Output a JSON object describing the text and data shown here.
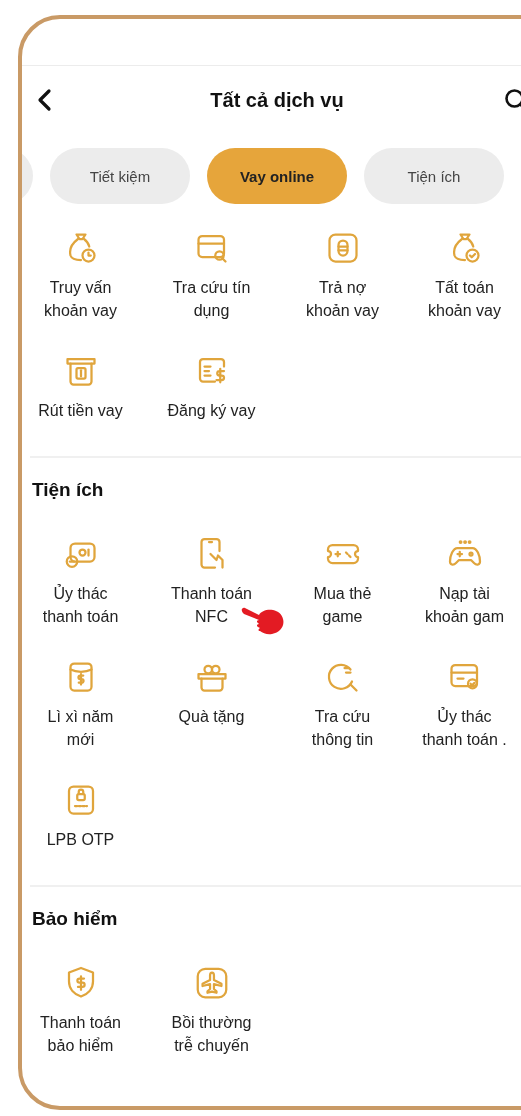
{
  "header": {
    "title": "Tất cả dịch vụ"
  },
  "tabs": [
    {
      "label": "Tiết kiệm",
      "selected": false
    },
    {
      "label": "Vay online",
      "selected": true
    },
    {
      "label": "Tiện ích",
      "selected": false
    }
  ],
  "sections": [
    {
      "items": [
        {
          "lines": [
            "Truy vấn",
            "khoản vay"
          ]
        },
        {
          "lines": [
            "Tra cứu tín",
            "dụng"
          ]
        },
        {
          "lines": [
            "Trả nợ",
            "khoản vay"
          ]
        },
        {
          "lines": [
            "Tất toán",
            "khoản vay"
          ]
        },
        {
          "lines": [
            "Rút tiền vay"
          ]
        },
        {
          "lines": [
            "Đăng ký vay"
          ]
        }
      ]
    },
    {
      "title": "Tiện ích",
      "items": [
        {
          "lines": [
            "Ủy thác",
            "thanh toán"
          ]
        },
        {
          "lines": [
            "Thanh toán",
            "NFC"
          ]
        },
        {
          "lines": [
            "Mua thẻ",
            "game"
          ]
        },
        {
          "lines": [
            "Nạp tài",
            "khoản gam"
          ]
        },
        {
          "lines": [
            "Lì xì năm",
            "mới"
          ]
        },
        {
          "lines": [
            "Quà tặng"
          ]
        },
        {
          "lines": [
            "Tra cứu",
            "thông tin"
          ]
        },
        {
          "lines": [
            "Ủy thác",
            "thanh toán ."
          ]
        },
        {
          "lines": [
            "LPB OTP"
          ]
        }
      ]
    },
    {
      "title": "Bảo hiểm",
      "items": [
        {
          "lines": [
            "Thanh toán",
            "bảo hiểm"
          ]
        },
        {
          "lines": [
            "Bồi thường",
            "trễ chuyến"
          ]
        }
      ]
    }
  ]
}
